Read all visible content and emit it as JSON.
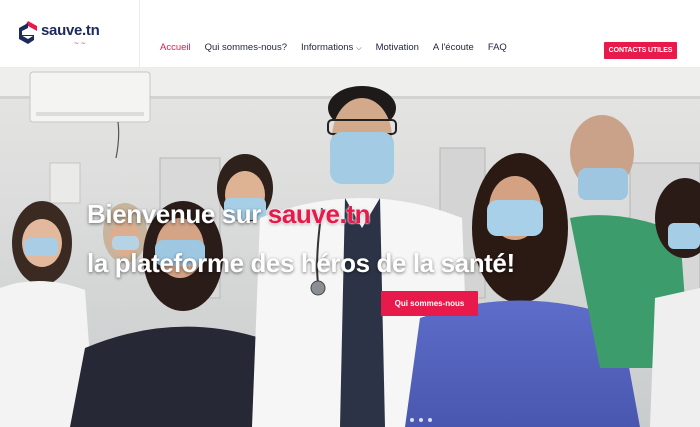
{
  "header": {
    "logo_text": "sauve.tn",
    "logo_tagline": "~ ~",
    "nav": [
      {
        "label": "Accueil",
        "active": true
      },
      {
        "label": "Qui sommes-nous?",
        "active": false
      },
      {
        "label": "Informations",
        "active": false,
        "has_dropdown": true
      },
      {
        "label": "Motivation",
        "active": false
      },
      {
        "label": "A l'écoute",
        "active": false
      },
      {
        "label": "FAQ",
        "active": false
      }
    ],
    "cta_label": "CONTACTS UTILES",
    "chevron_glyph": "⌵"
  },
  "hero": {
    "line1_prefix": "Bienvenue sur ",
    "line1_brand": "sauve.tn",
    "line2": "la plateforme des héros de la santé!",
    "button_label": "Qui sommes-nous"
  },
  "colors": {
    "accent": "#e8194b",
    "brand_dark": "#1c2a5c",
    "nav_text": "#1d2242"
  }
}
